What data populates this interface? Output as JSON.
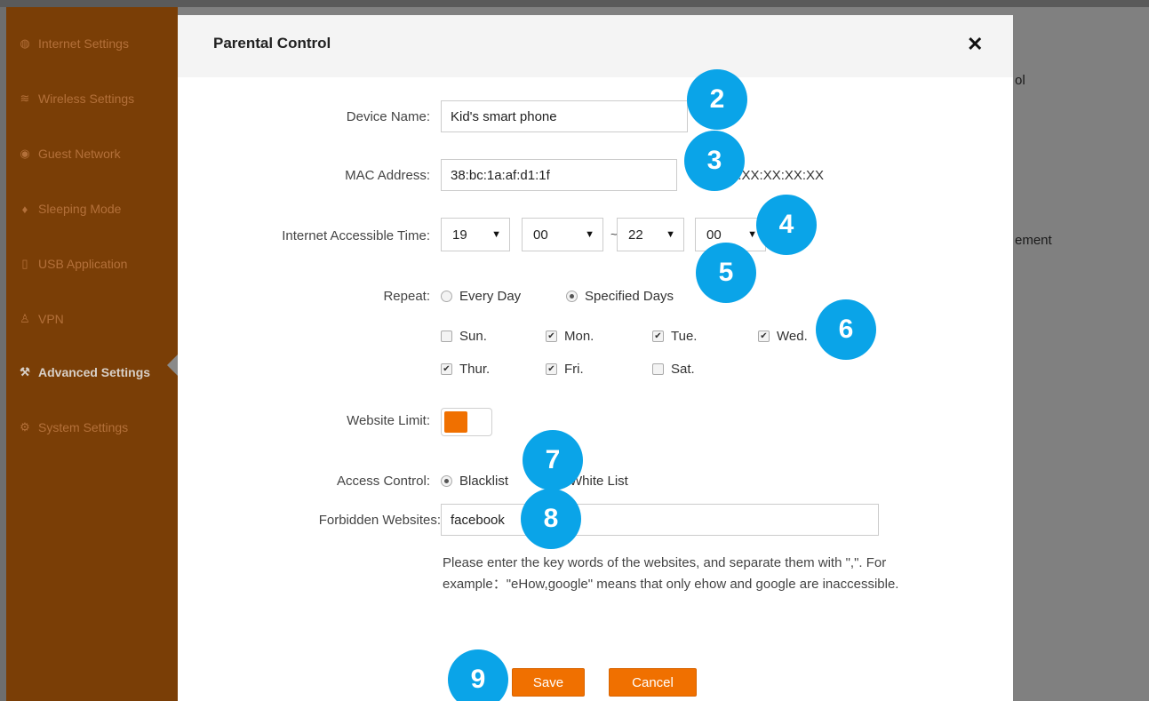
{
  "sidebar": {
    "items": [
      {
        "icon": "globe-icon",
        "glyph": "◍",
        "label": "Internet Settings"
      },
      {
        "icon": "wifi-icon",
        "glyph": "≋",
        "label": "Wireless Settings"
      },
      {
        "icon": "guest-icon",
        "glyph": "◉",
        "label": "Guest Network"
      },
      {
        "icon": "bulb-icon",
        "glyph": "♦",
        "label": "Sleeping Mode"
      },
      {
        "icon": "usb-icon",
        "glyph": "▯",
        "label": "USB Application"
      },
      {
        "icon": "vpn-icon",
        "glyph": "♙",
        "label": "VPN"
      },
      {
        "icon": "wrench-icon",
        "glyph": "⚒",
        "label": "Advanced Settings"
      },
      {
        "icon": "gear-icon",
        "glyph": "⚙",
        "label": "System Settings"
      }
    ]
  },
  "background": {
    "fragment_1": "ol",
    "fragment_2": "ement"
  },
  "dialog": {
    "title": "Parental Control",
    "close_glyph": "✕",
    "device_name_label": "Device Name:",
    "device_name_value": "Kid's smart phone",
    "mac_label": "MAC Address:",
    "mac_value": "38:bc:1a:af:d1:1f",
    "mac_hint": "( XX:XX:XX:XX:XX:XX",
    "time_label": "Internet Accessible Time:",
    "start_hour": "19",
    "start_minute": "00",
    "tilde": "~",
    "end_hour": "22",
    "end_minute": "00",
    "caret": "▼",
    "repeat_label": "Repeat:",
    "repeat_every_day": "Every Day",
    "repeat_specified": "Specified Days",
    "days": {
      "sun": "Sun.",
      "mon": "Mon.",
      "tue": "Tue.",
      "wed": "Wed.",
      "thu": "Thur.",
      "fri": "Fri.",
      "sat": "Sat."
    },
    "check_mark": "✔",
    "website_limit_label": "Website Limit:",
    "access_control_label": "Access Control:",
    "blacklist": "Blacklist",
    "whitelist": "White List",
    "forbidden_label": "Forbidden Websites:",
    "forbidden_value": "facebook",
    "help_text": "Please enter the key words of the websites, and separate them with \",\". For example：\"eHow,google\" means that only ehow and google are inaccessible.",
    "save_label": "Save",
    "cancel_label": "Cancel"
  },
  "markers": [
    "2",
    "3",
    "4",
    "5",
    "6",
    "7",
    "8",
    "9"
  ],
  "colors": {
    "accent": "#f07000",
    "sidebar": "#7a3e06",
    "marker": "#0aa4e8"
  }
}
